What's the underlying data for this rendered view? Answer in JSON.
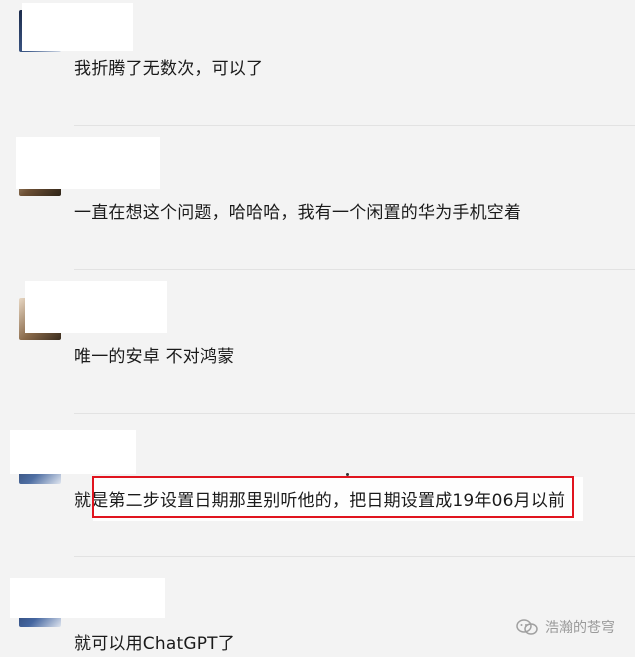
{
  "comments": [
    {
      "text": "我折腾了无数次，可以了",
      "avatar_icon": "user-avatar-icon"
    },
    {
      "text": "一直在想这个问题，哈哈哈，我有一个闲置的华为手机空着",
      "avatar_icon": "user-avatar-icon"
    },
    {
      "text": "唯一的安卓 不对鸿蒙",
      "avatar_icon": "user-avatar-icon"
    },
    {
      "text": "就是第二步设置日期那里别听他的，把日期设置成19年06月以前",
      "avatar_icon": "user-avatar-icon"
    },
    {
      "text": "就可以用ChatGPT了",
      "avatar_icon": "user-avatar-icon"
    }
  ],
  "watermark": {
    "label": "浩瀚的苍穹",
    "icon": "wechat-channel-icon"
  },
  "colors": {
    "highlight": "#e0141e",
    "background": "#f3f3f3"
  }
}
